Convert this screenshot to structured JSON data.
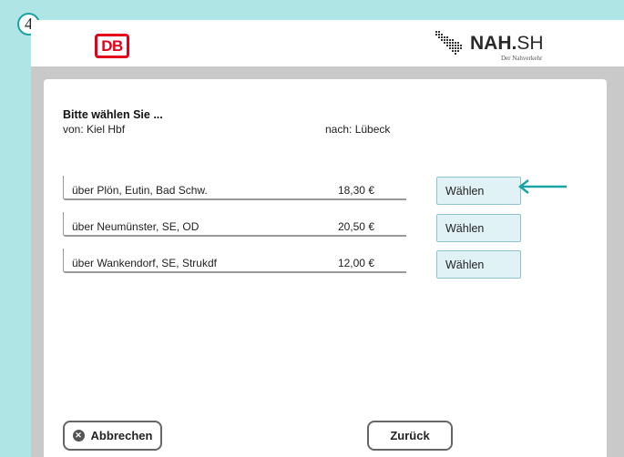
{
  "step_number": "4",
  "header": {
    "db_logo_text": "DB",
    "nah_brand_bold": "NAH.",
    "nah_brand_light": "SH",
    "nah_tagline": "Der Nahverkehr"
  },
  "selection": {
    "heading": "Bitte wählen Sie ...",
    "from": "von: Kiel Hbf",
    "to": "nach: Lübeck"
  },
  "routes": [
    {
      "label": "über Plön, Eutin, Bad Schw.",
      "price": "18,30 €",
      "button": "Wählen"
    },
    {
      "label": "über Neumünster, SE, OD",
      "price": "20,50 €",
      "button": "Wählen"
    },
    {
      "label": "über Wankendorf, SE, Strukdf",
      "price": "12,00 €",
      "button": "Wählen"
    }
  ],
  "footer": {
    "cancel_label": "Abbrechen",
    "back_label": "Zurück",
    "cancel_icon": "x-circle-icon"
  },
  "colors": {
    "background": "#b0e5e5",
    "accent": "#1aa3a3",
    "db_red": "#e2001a",
    "select_button": "#e1f2f7"
  }
}
